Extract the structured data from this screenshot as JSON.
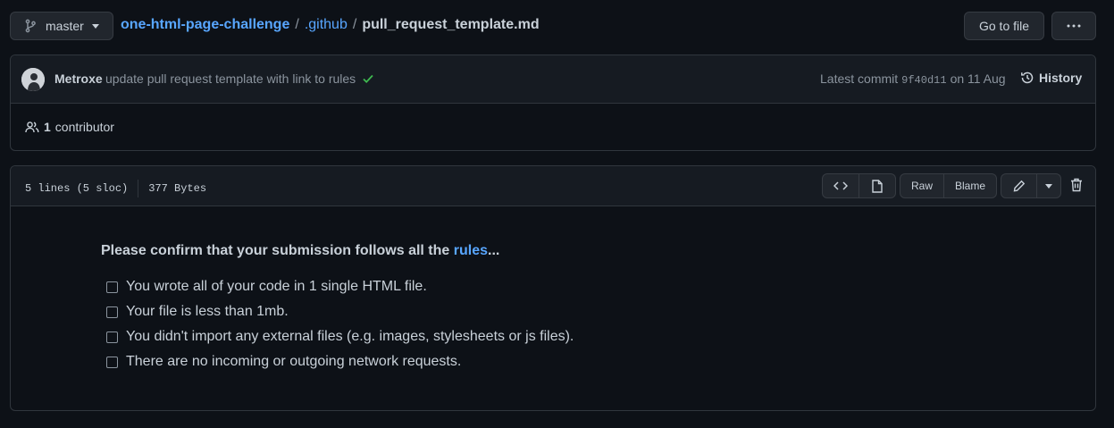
{
  "topbar": {
    "branch": "master",
    "breadcrumb": {
      "repo": "one-html-page-challenge",
      "folder": ".github",
      "file": "pull_request_template.md",
      "separator": "/"
    },
    "goto_file": "Go to file",
    "more_icon": "kebab-horizontal-icon"
  },
  "commit": {
    "author": "Metroxe",
    "message": "update pull request template with link to rules",
    "status": "success",
    "latest_label": "Latest commit",
    "sha": "9f40d11",
    "date": "on 11 Aug",
    "history": "History"
  },
  "contributors": {
    "count": "1",
    "label": "contributor"
  },
  "file": {
    "lines": "5 lines (5 sloc)",
    "size": "377 Bytes",
    "raw": "Raw",
    "blame": "Blame"
  },
  "content": {
    "heading_prefix": "Please confirm that your submission follows all the",
    "heading_link": "rules",
    "heading_suffix": "...",
    "tasks": [
      "You wrote all of your code in 1 single HTML file.",
      "Your file is less than 1mb.",
      "You didn't import any external files (e.g. images, stylesheets or js files).",
      "There are no incoming or outgoing network requests."
    ]
  },
  "colors": {
    "background": "#0d1117",
    "link": "#58a6ff",
    "success": "#3fb950",
    "border": "#30363d"
  }
}
